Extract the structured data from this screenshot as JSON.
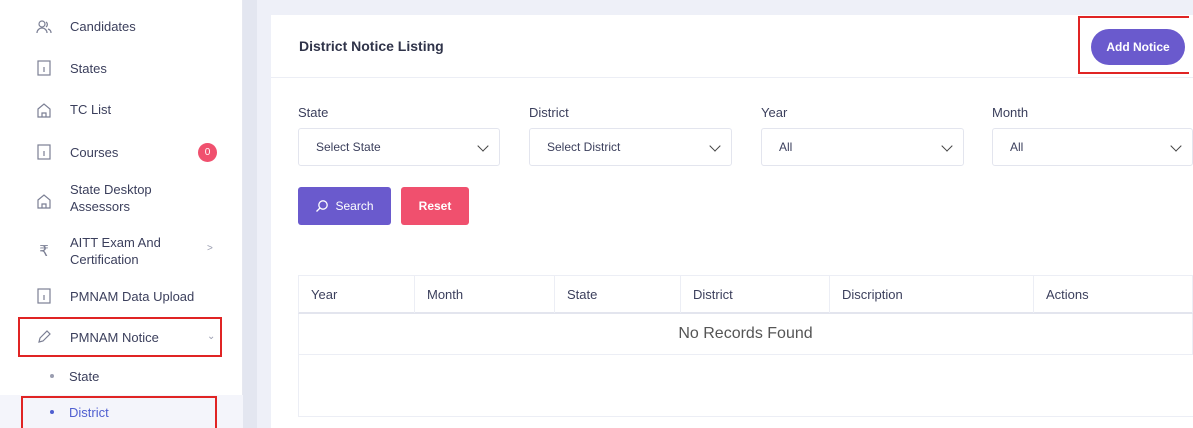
{
  "sidebar": {
    "items": [
      {
        "label": "Candidates",
        "icon": "users-icon"
      },
      {
        "label": "States",
        "icon": "file-icon"
      },
      {
        "label": "TC List",
        "icon": "home-icon"
      },
      {
        "label": "Courses",
        "icon": "file-icon",
        "badge": "0"
      },
      {
        "label": "State Desktop Assessors",
        "icon": "home-icon"
      },
      {
        "label": "AITT Exam And Certification",
        "icon": "rupee-icon"
      },
      {
        "label": "PMNAM Data Upload",
        "icon": "file-icon"
      },
      {
        "label": "PMNAM Notice",
        "icon": "pencil-icon"
      }
    ],
    "subitems": [
      {
        "label": "State"
      },
      {
        "label": "District"
      }
    ]
  },
  "panel": {
    "title": "District Notice Listing",
    "add_button": "Add Notice"
  },
  "filters": {
    "state": {
      "label": "State",
      "value": "Select State"
    },
    "district": {
      "label": "District",
      "value": "Select District"
    },
    "year": {
      "label": "Year",
      "value": "All"
    },
    "month": {
      "label": "Month",
      "value": "All"
    }
  },
  "buttons": {
    "search": "Search",
    "reset": "Reset"
  },
  "table": {
    "columns": [
      "Year",
      "Month",
      "State",
      "District",
      "Discription",
      "Actions"
    ],
    "empty_text": "No Records Found"
  },
  "colors": {
    "primary": "#6a5acd",
    "danger": "#f0506e",
    "highlight": "#e02424"
  }
}
